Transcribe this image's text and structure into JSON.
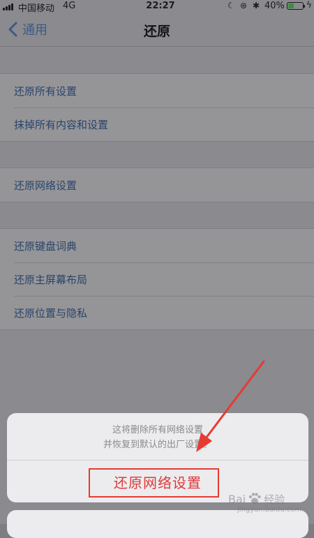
{
  "status_bar": {
    "carrier": "中国移动",
    "network": "4G",
    "time": "22:27",
    "battery": "40%",
    "battery_level": 0.4
  },
  "nav": {
    "back_label": "通用",
    "title": "还原"
  },
  "groups": [
    {
      "items": [
        {
          "label": "还原所有设置"
        },
        {
          "label": "抹掉所有内容和设置"
        }
      ]
    },
    {
      "items": [
        {
          "label": "还原网络设置"
        }
      ]
    },
    {
      "items": [
        {
          "label": "还原键盘词典"
        },
        {
          "label": "还原主屏幕布局"
        },
        {
          "label": "还原位置与隐私"
        }
      ]
    }
  ],
  "action_sheet": {
    "message_line1": "这将删除所有网络设置",
    "message_line2": "并恢复到默认的出厂设置。",
    "action_label": "还原网络设置",
    "action_color": "#e0393a"
  },
  "annotation": {
    "color": "#e53b32"
  },
  "watermark": {
    "prefix": "Bai",
    "suffix": "经验",
    "sub": "jingyan.baidu.com"
  }
}
